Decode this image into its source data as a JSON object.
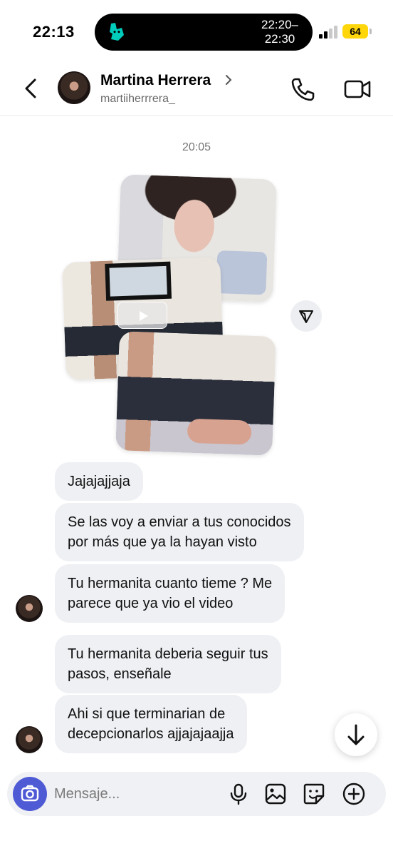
{
  "status_bar": {
    "time": "22:13",
    "live_activity_time_start": "22:20–",
    "live_activity_time_end": "22:30",
    "battery": "64",
    "live_activity_app_icon": "deliveroo-kangaroo-icon",
    "battery_color": "#ffd60a"
  },
  "header": {
    "contact_name": "Martina Herrera",
    "contact_handle": "martiiherrrera_",
    "icons": [
      "back-chevron-icon",
      "phone-icon",
      "video-camera-icon"
    ]
  },
  "thread": {
    "timestamp": "20:05",
    "media_icons": [
      "play-icon",
      "share-send-icon"
    ],
    "messages": [
      {
        "text": "Jajajajjaja"
      },
      {
        "text": "Se las voy a enviar a tus conocidos\npor más que ya la hayan visto"
      },
      {
        "text": "Tu hermanita cuanto tieme ? Me\nparece que ya vio el video"
      },
      {
        "text": "Tu hermanita deberia seguir tus\npasos,  enseñale"
      },
      {
        "text": "Ahi si que terminarian de\ndecepcionarlos ajjajajaajja"
      }
    ]
  },
  "composer": {
    "placeholder": "Mensaje...",
    "icons": [
      "camera-icon",
      "microphone-icon",
      "gallery-icon",
      "sticker-icon",
      "plus-icon"
    ],
    "accent_color": "#4f5bd5"
  }
}
